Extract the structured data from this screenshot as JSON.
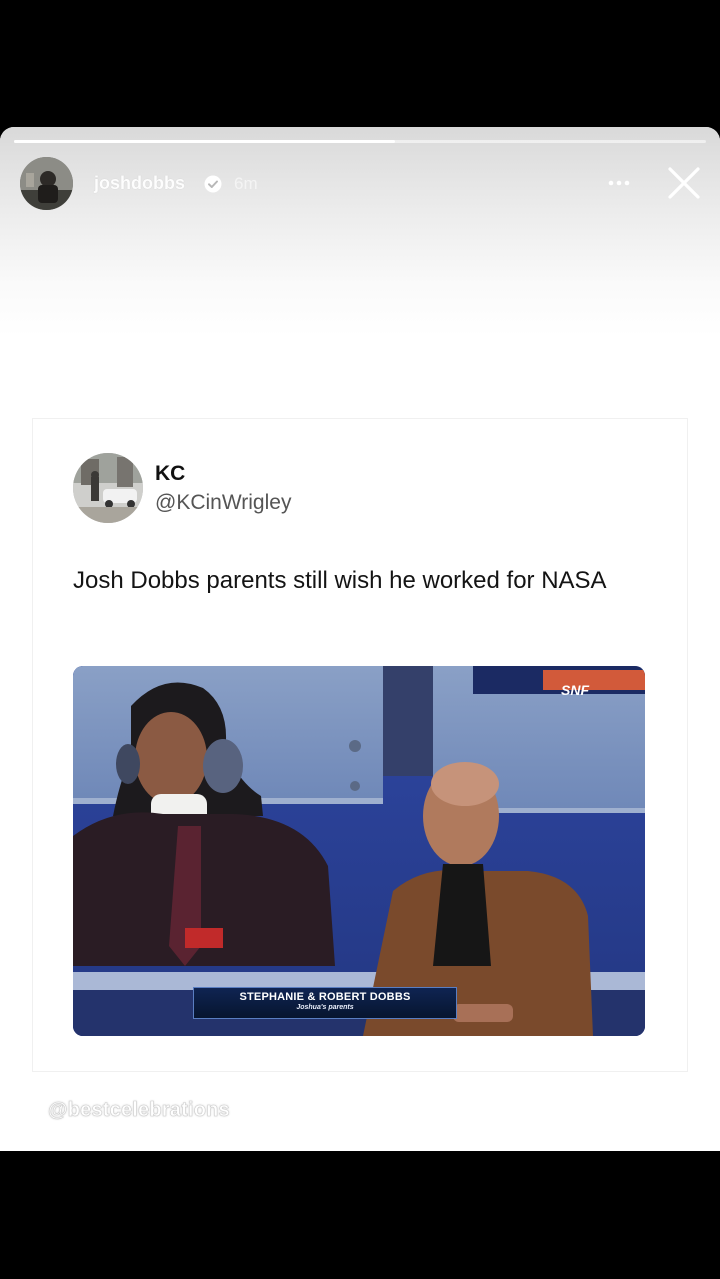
{
  "story": {
    "progress_fraction": 0.55,
    "username": "joshdobbs",
    "verified": true,
    "time": "6m",
    "more_icon": "more-horizontal-icon",
    "close_icon": "close-icon"
  },
  "tweet": {
    "name": "KC",
    "handle": "@KCinWrigley",
    "text": "Josh Dobbs parents still wish he worked for NASA",
    "media": {
      "network_logo": "SNF",
      "lower_third_name": "STEPHANIE & ROBERT DOBBS",
      "lower_third_sub": "Joshua's parents"
    }
  },
  "watermark": "@bestcelebrations",
  "colors": {
    "story_background": "#ffffff",
    "outer_background": "#000000",
    "tweet_text": "#141414",
    "tweet_handle": "#555555",
    "stadium_blue": "#2b3f8c"
  }
}
